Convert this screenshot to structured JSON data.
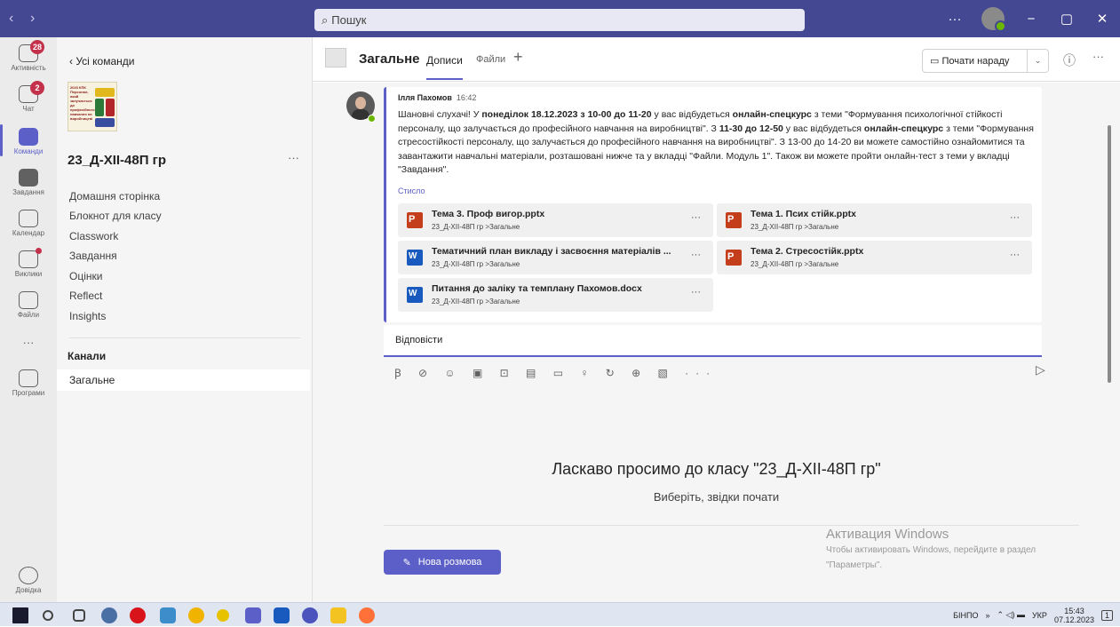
{
  "titlebar": {
    "search_placeholder": "Пошук",
    "back_glyph": "‹",
    "fwd_glyph": "›",
    "more_glyph": "···",
    "min_glyph": "−",
    "max_glyph": "▢",
    "close_glyph": "✕"
  },
  "rail": {
    "items": [
      {
        "label": "Активність",
        "badge": "28",
        "icon": "bell-icon"
      },
      {
        "label": "Чат",
        "badge": "2",
        "icon": "chat-icon"
      },
      {
        "label": "Команди",
        "icon": "teams-icon"
      },
      {
        "label": "Завдання",
        "icon": "assignments-icon"
      },
      {
        "label": "Календар",
        "icon": "calendar-icon"
      },
      {
        "label": "Виклики",
        "icon": "phone-icon"
      },
      {
        "label": "Файли",
        "icon": "file-icon"
      },
      {
        "label": "···",
        "icon": "more-icon"
      },
      {
        "label": "Програми",
        "icon": "apps-icon"
      },
      {
        "label": "Довідка",
        "icon": "help-icon"
      }
    ]
  },
  "team_pane": {
    "back_label": "‹  Усі команди",
    "logo_text": "2023 КПК Персонал, який залучається до професійного навчання на виробництві",
    "team_name": "23_Д-XII-48П гр",
    "more": "···",
    "items": [
      "Домашня сторінка",
      "Блокнот для класу",
      "Classwork",
      "Завдання",
      "Оцінки",
      "Reflect",
      "Insights"
    ],
    "channels_heading": "Канали",
    "channel": "Загальне"
  },
  "header": {
    "title": "Загальне",
    "tab_posts": "Дописи",
    "tab_files": "Файли",
    "plus": "+",
    "meet_label": "Почати нараду",
    "meet_caret": "⌄",
    "info": "ⓘ",
    "more": "···"
  },
  "post": {
    "author": "Ілля Пахомов",
    "time": "16:42",
    "body_html_parts": {
      "p1": "Шановні слухачі! У ",
      "b1": "понеділок 18.12.2023 з 10-00 до 11-20",
      "p2": " у вас відбудеться ",
      "b2": "онлайн-спецкурс",
      "p3": " з теми \"Формування психологічної стійкості персоналу, що залучається до професійного навчання на виробництві\". З ",
      "b3": "11-30 до 12-50",
      "p4": " у вас відбудеться ",
      "b4": "онлайн-спецкурс",
      "p5": " з теми \"Формування стресостійкості персоналу, що залучається до професійного навчання на виробництві\". З 13-00 до 14-20 ви можете самостійно ознайомитися та завантажити навчальні матеріали, розташовані нижче та у вкладці \"Файли. Модуль 1\". Також ви можете пройти онлайн-тест з теми у вкладці \"Завдання\"."
    },
    "collapse": "Стисло",
    "files": [
      {
        "name": "Тема 3. Проф вигор.pptx",
        "path": "23_Д-XII-48П гр >Загальне",
        "type": "ppt"
      },
      {
        "name": "Тема 1. Псих стійк.pptx",
        "path": "23_Д-XII-48П гр >Загальне",
        "type": "ppt"
      },
      {
        "name": "Тематичний план викладу і засвоєння матеріалів ...",
        "path": "23_Д-XII-48П гр >Загальне",
        "type": "doc"
      },
      {
        "name": "Тема 2. Стресостійк.pptx",
        "path": "23_Д-XII-48П гр >Загальне",
        "type": "ppt"
      },
      {
        "name": "Питання до заліку та темплану Пахомов.docx",
        "path": "23_Д-XII-48П гр >Загальне",
        "type": "doc"
      }
    ],
    "file_more": "···"
  },
  "reply": {
    "label": "Відповісти",
    "toolbar": "Ꞵ ⊘ ☺ ▣ ⊡ ▤ ▭ ♀ ↻ ⊕ ▧ ···",
    "send": "▷"
  },
  "welcome": {
    "title": "Ласкаво просимо до класу \"23_Д-XII-48П гр\"",
    "subtitle": "Виберіть, звідки почати",
    "new_conv": "Нова розмова"
  },
  "watermark": {
    "line1": "Активация Windows",
    "line2": "Чтобы активировать Windows, перейдите в раздел",
    "line3": "\"Параметры\"."
  },
  "taskbar": {
    "lang1": "БІНПО",
    "lang2": "УКР",
    "time": "15:43",
    "date": "07.12.2023",
    "chev": "»",
    "notif": "1"
  },
  "colors": {
    "accent": "#5b5fc7",
    "titlebar": "#444791"
  }
}
